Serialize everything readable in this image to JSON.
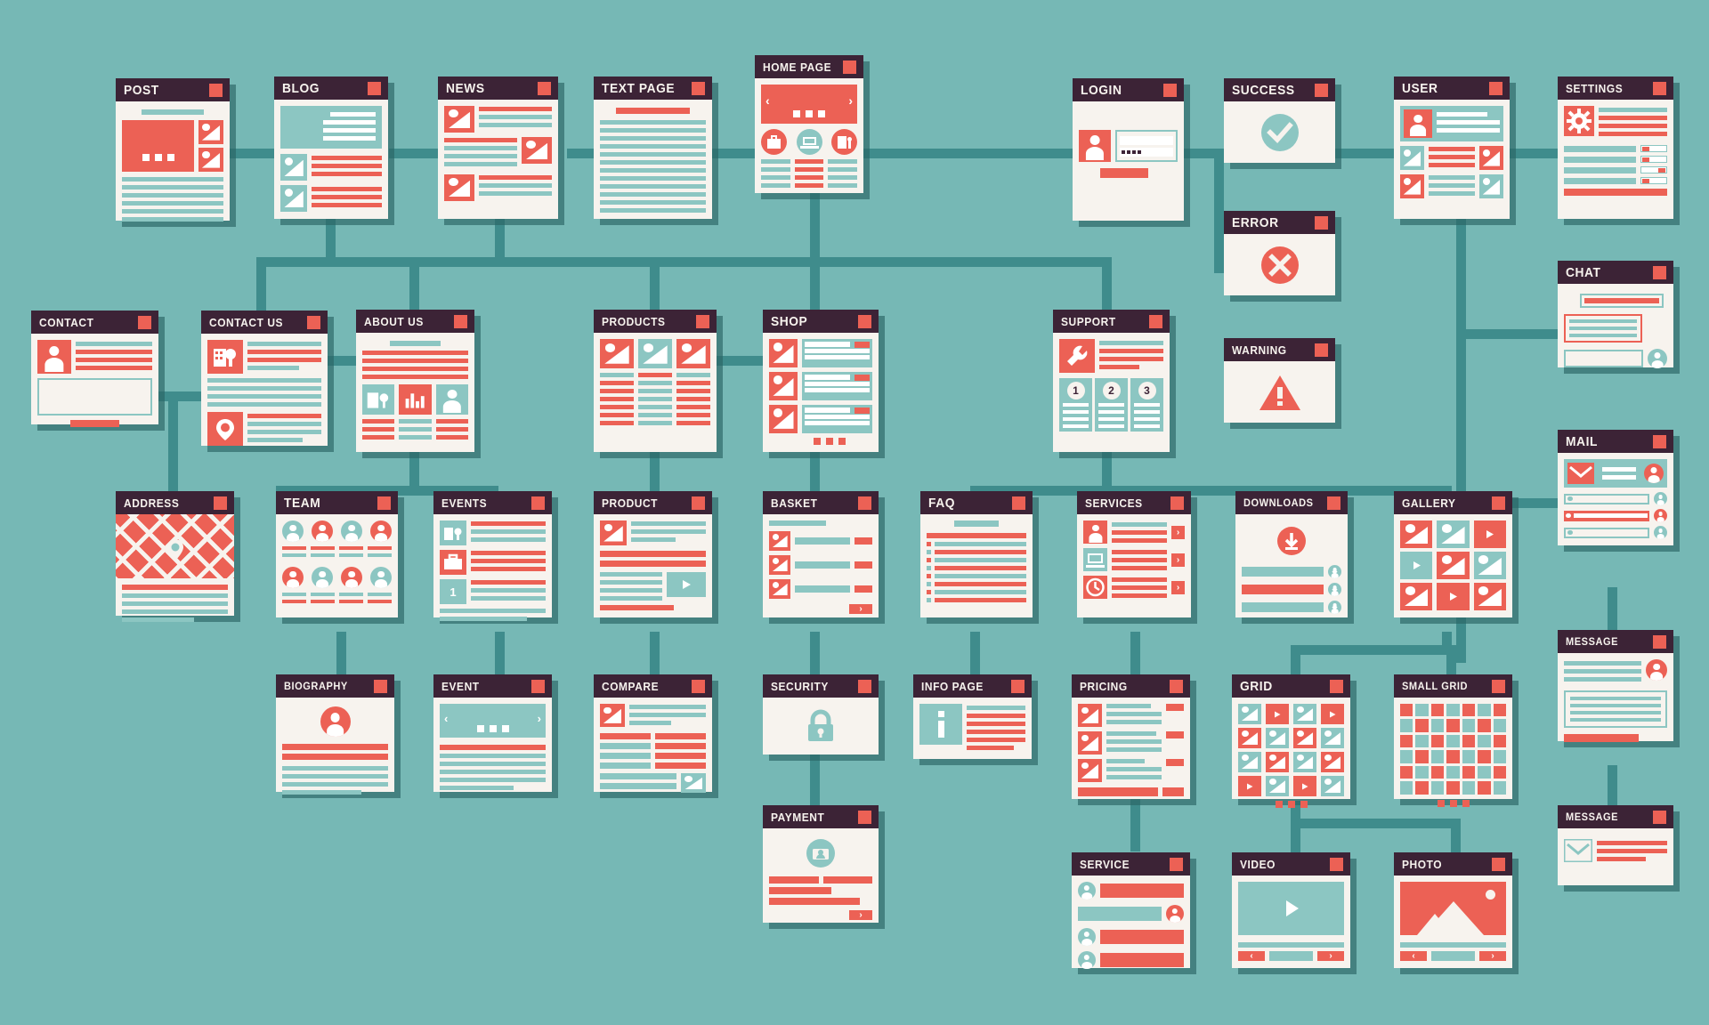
{
  "meta": {
    "title": "Website Sitemap Flowchart",
    "background_color": "#76b8b5",
    "line_color": "#3f8c8c",
    "card_bg": "#f7f3ee",
    "titlebar_color": "#3c2336",
    "accent_red": "#ec6155",
    "accent_teal": "#8cc6c2"
  },
  "chart_data": {
    "type": "diagram",
    "title": "Website Sitemap Flowchart",
    "nodes": [
      {
        "id": "post",
        "label": "POST",
        "row": 1
      },
      {
        "id": "blog",
        "label": "BLOG",
        "row": 1
      },
      {
        "id": "news",
        "label": "NEWS",
        "row": 1
      },
      {
        "id": "text_page",
        "label": "TEXT PAGE",
        "row": 1
      },
      {
        "id": "home_page",
        "label": "HOME PAGE",
        "row": 1
      },
      {
        "id": "login",
        "label": "LOGIN",
        "row": 1
      },
      {
        "id": "success",
        "label": "SUCCESS",
        "row": 1
      },
      {
        "id": "user",
        "label": "USER",
        "row": 1
      },
      {
        "id": "settings",
        "label": "SETTINGS",
        "row": 1
      },
      {
        "id": "error",
        "label": "ERROR",
        "row": 2
      },
      {
        "id": "contact",
        "label": "CONTACT",
        "row": 2
      },
      {
        "id": "contact_us",
        "label": "CONTACT US",
        "row": 2
      },
      {
        "id": "about_us",
        "label": "ABOUT US",
        "row": 2
      },
      {
        "id": "products",
        "label": "PRODUCTS",
        "row": 2
      },
      {
        "id": "shop",
        "label": "SHOP",
        "row": 2
      },
      {
        "id": "support",
        "label": "SUPPORT",
        "row": 2
      },
      {
        "id": "warning",
        "label": "WARNING",
        "row": 2
      },
      {
        "id": "chat",
        "label": "CHAT",
        "row": 2
      },
      {
        "id": "mail",
        "label": "MAIL",
        "row": 3
      },
      {
        "id": "address",
        "label": "ADDRESS",
        "row": 3
      },
      {
        "id": "team",
        "label": "TEAM",
        "row": 3
      },
      {
        "id": "events",
        "label": "EVENTS",
        "row": 3
      },
      {
        "id": "product",
        "label": "PRODUCT",
        "row": 3
      },
      {
        "id": "basket",
        "label": "BASKET",
        "row": 3
      },
      {
        "id": "faq",
        "label": "FAQ",
        "row": 3
      },
      {
        "id": "services",
        "label": "SERVICES",
        "row": 3
      },
      {
        "id": "downloads",
        "label": "DOWNLOADS",
        "row": 3
      },
      {
        "id": "gallery",
        "label": "GALLERY",
        "row": 3
      },
      {
        "id": "message_1",
        "label": "MESSAGE",
        "row": 4
      },
      {
        "id": "biography",
        "label": "BIOGRAPHY",
        "row": 4
      },
      {
        "id": "event",
        "label": "EVENT",
        "row": 4
      },
      {
        "id": "compare",
        "label": "COMPARE",
        "row": 4
      },
      {
        "id": "security",
        "label": "SECURITY",
        "row": 4
      },
      {
        "id": "info_page",
        "label": "INFO PAGE",
        "row": 4
      },
      {
        "id": "pricing",
        "label": "PRICING",
        "row": 4
      },
      {
        "id": "grid",
        "label": "GRID",
        "row": 4
      },
      {
        "id": "small_grid",
        "label": "SMALL GRID",
        "row": 4
      },
      {
        "id": "payment",
        "label": "PAYMENT",
        "row": 5
      },
      {
        "id": "message_2",
        "label": "MESSAGE",
        "row": 5
      },
      {
        "id": "service",
        "label": "SERVICE",
        "row": 5
      },
      {
        "id": "video",
        "label": "VIDEO",
        "row": 5
      },
      {
        "id": "photo",
        "label": "PHOTO",
        "row": 5
      }
    ],
    "edges": [
      [
        "post",
        "blog"
      ],
      [
        "blog",
        "news"
      ],
      [
        "news",
        "text_page"
      ],
      [
        "text_page",
        "home_page"
      ],
      [
        "home_page",
        "login"
      ],
      [
        "login",
        "success"
      ],
      [
        "login",
        "error"
      ],
      [
        "success",
        "user"
      ],
      [
        "user",
        "settings"
      ],
      [
        "user",
        "chat"
      ],
      [
        "home_page",
        "about_us"
      ],
      [
        "home_page",
        "contact_us"
      ],
      [
        "home_page",
        "products"
      ],
      [
        "home_page",
        "shop"
      ],
      [
        "home_page",
        "support"
      ],
      [
        "blog",
        "about_us"
      ],
      [
        "news",
        "about_us"
      ],
      [
        "contact",
        "contact_us"
      ],
      [
        "contact_us",
        "about_us"
      ],
      [
        "products",
        "shop"
      ],
      [
        "chat",
        "mail"
      ],
      [
        "mail",
        "message_1"
      ],
      [
        "contact_us",
        "address"
      ],
      [
        "about_us",
        "team"
      ],
      [
        "about_us",
        "events"
      ],
      [
        "products",
        "product"
      ],
      [
        "shop",
        "basket"
      ],
      [
        "support",
        "faq"
      ],
      [
        "support",
        "services"
      ],
      [
        "support",
        "downloads"
      ],
      [
        "support",
        "gallery"
      ],
      [
        "team",
        "biography"
      ],
      [
        "events",
        "event"
      ],
      [
        "product",
        "compare"
      ],
      [
        "basket",
        "security"
      ],
      [
        "security",
        "payment"
      ],
      [
        "faq",
        "info_page"
      ],
      [
        "services",
        "pricing"
      ],
      [
        "gallery",
        "grid"
      ],
      [
        "gallery",
        "small_grid"
      ],
      [
        "pricing",
        "service"
      ],
      [
        "grid",
        "video"
      ],
      [
        "grid",
        "photo"
      ],
      [
        "message_1",
        "message_2"
      ]
    ]
  },
  "cards": {
    "post": {
      "title": "POST"
    },
    "blog": {
      "title": "BLOG"
    },
    "news": {
      "title": "NEWS"
    },
    "text_page": {
      "title": "TEXT PAGE"
    },
    "home_page": {
      "title": "HOME PAGE"
    },
    "login": {
      "title": "LOGIN"
    },
    "success": {
      "title": "SUCCESS"
    },
    "error": {
      "title": "ERROR"
    },
    "warning": {
      "title": "WARNING"
    },
    "user": {
      "title": "USER"
    },
    "settings": {
      "title": "SETTINGS"
    },
    "chat": {
      "title": "CHAT"
    },
    "mail": {
      "title": "MAIL"
    },
    "message_1": {
      "title": "MESSAGE"
    },
    "message_2": {
      "title": "MESSAGE"
    },
    "contact": {
      "title": "CONTACT"
    },
    "contact_us": {
      "title": "CONTACT US"
    },
    "about_us": {
      "title": "ABOUT US"
    },
    "products": {
      "title": "PRODUCTS"
    },
    "shop": {
      "title": "SHOP"
    },
    "support": {
      "title": "SUPPORT",
      "steps": [
        "1",
        "2",
        "3"
      ]
    },
    "address": {
      "title": "ADDRESS"
    },
    "team": {
      "title": "TEAM"
    },
    "events": {
      "title": "EVENTS",
      "day": "1"
    },
    "product": {
      "title": "PRODUCT"
    },
    "basket": {
      "title": "BASKET"
    },
    "faq": {
      "title": "FAQ"
    },
    "services": {
      "title": "SERVICES"
    },
    "downloads": {
      "title": "DOWNLOADS"
    },
    "gallery": {
      "title": "GALLERY"
    },
    "biography": {
      "title": "BIOGRAPHY"
    },
    "event": {
      "title": "EVENT"
    },
    "compare": {
      "title": "COMPARE"
    },
    "security": {
      "title": "SECURITY"
    },
    "payment": {
      "title": "PAYMENT"
    },
    "info_page": {
      "title": "INFO PAGE"
    },
    "pricing": {
      "title": "PRICING"
    },
    "grid": {
      "title": "GRID"
    },
    "small_grid": {
      "title": "SMALL GRID"
    },
    "service": {
      "title": "SERVICE"
    },
    "video": {
      "title": "VIDEO"
    },
    "photo": {
      "title": "PHOTO"
    }
  }
}
